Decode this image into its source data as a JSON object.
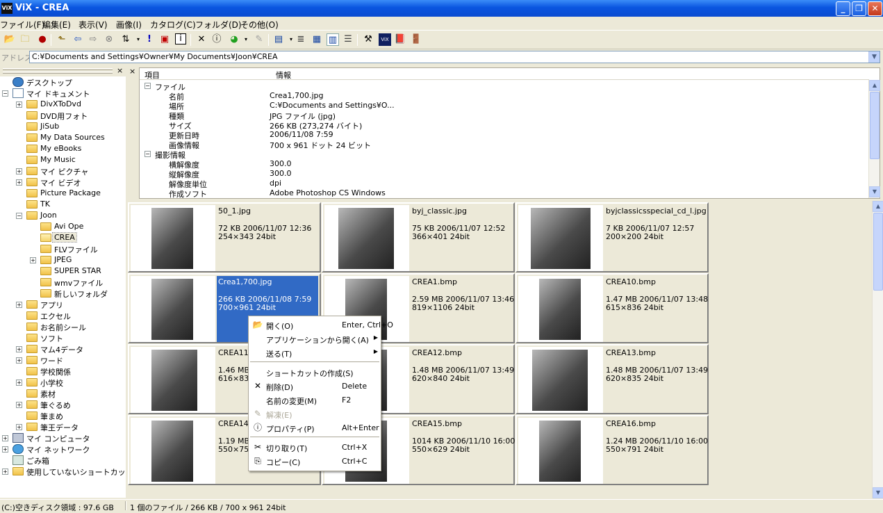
{
  "window": {
    "title": "ViX - CREA",
    "app_icon": "ViX"
  },
  "menu": [
    "ファイル(F)",
    "編集(E)",
    "表示(V)",
    "画像(I)",
    "カタログ(C)",
    "フォルダ(D)",
    "その他(O)"
  ],
  "address": {
    "label": "アドレス",
    "value": "C:¥Documents and Settings¥Owner¥My Documents¥Joon¥CREA"
  },
  "tree": [
    {
      "label": "デスクトップ",
      "icon": "desktop-icon",
      "level": 0,
      "expand": ""
    },
    {
      "label": "マイ ドキュメント",
      "icon": "my-documents-icon",
      "level": 0,
      "expand": "−"
    },
    {
      "label": "DivXToDvd",
      "icon": "folder-icon",
      "level": 1,
      "expand": "+"
    },
    {
      "label": "DVD用フォト",
      "icon": "folder-icon",
      "level": 1,
      "expand": ""
    },
    {
      "label": "JiSub",
      "icon": "folder-icon",
      "level": 1,
      "expand": ""
    },
    {
      "label": "My Data Sources",
      "icon": "folder-icon",
      "level": 1,
      "expand": ""
    },
    {
      "label": "My eBooks",
      "icon": "folder-icon",
      "level": 1,
      "expand": ""
    },
    {
      "label": "My Music",
      "icon": "folder-icon",
      "level": 1,
      "expand": ""
    },
    {
      "label": "マイ ピクチャ",
      "icon": "pictures-folder-icon",
      "level": 1,
      "expand": "+"
    },
    {
      "label": "マイ ビデオ",
      "icon": "video-folder-icon",
      "level": 1,
      "expand": "+"
    },
    {
      "label": "Picture Package",
      "icon": "folder-icon",
      "level": 1,
      "expand": ""
    },
    {
      "label": "TK",
      "icon": "folder-icon",
      "level": 1,
      "expand": ""
    },
    {
      "label": "Joon",
      "icon": "folder-icon",
      "level": 1,
      "expand": "−"
    },
    {
      "label": "Avi Ope",
      "icon": "folder-icon",
      "level": 2,
      "expand": ""
    },
    {
      "label": "CREA",
      "icon": "open-folder-icon",
      "level": 2,
      "expand": "",
      "selected": true
    },
    {
      "label": "FLVファイル",
      "icon": "folder-icon",
      "level": 2,
      "expand": ""
    },
    {
      "label": "JPEG",
      "icon": "folder-icon",
      "level": 2,
      "expand": "+"
    },
    {
      "label": "SUPER STAR",
      "icon": "folder-icon",
      "level": 2,
      "expand": ""
    },
    {
      "label": "wmvファイル",
      "icon": "folder-icon",
      "level": 2,
      "expand": ""
    },
    {
      "label": "新しいフォルダ",
      "icon": "folder-icon",
      "level": 2,
      "expand": ""
    },
    {
      "label": "アプリ",
      "icon": "folder-icon",
      "level": 1,
      "expand": "+"
    },
    {
      "label": "エクセル",
      "icon": "folder-icon",
      "level": 1,
      "expand": ""
    },
    {
      "label": "お名前シール",
      "icon": "folder-icon",
      "level": 1,
      "expand": ""
    },
    {
      "label": "ソフト",
      "icon": "folder-icon",
      "level": 1,
      "expand": ""
    },
    {
      "label": "マム4データ",
      "icon": "folder-icon",
      "level": 1,
      "expand": "+"
    },
    {
      "label": "ワード",
      "icon": "folder-icon",
      "level": 1,
      "expand": "+"
    },
    {
      "label": "学校関係",
      "icon": "folder-icon",
      "level": 1,
      "expand": ""
    },
    {
      "label": "小学校",
      "icon": "folder-icon",
      "level": 1,
      "expand": "+"
    },
    {
      "label": "素材",
      "icon": "folder-icon",
      "level": 1,
      "expand": ""
    },
    {
      "label": "筆ぐるめ",
      "icon": "folder-icon",
      "level": 1,
      "expand": "+"
    },
    {
      "label": "筆まめ",
      "icon": "folder-icon",
      "level": 1,
      "expand": ""
    },
    {
      "label": "筆王データ",
      "icon": "folder-icon",
      "level": 1,
      "expand": "+"
    },
    {
      "label": "マイ コンピュータ",
      "icon": "my-computer-icon",
      "level": 0,
      "expand": "+"
    },
    {
      "label": "マイ ネットワーク",
      "icon": "network-icon",
      "level": 0,
      "expand": "+"
    },
    {
      "label": "ごみ箱",
      "icon": "recycle-bin-icon",
      "level": 0,
      "expand": ""
    },
    {
      "label": "使用していないショートカット",
      "icon": "folder-icon",
      "level": 0,
      "expand": "+"
    }
  ],
  "props": {
    "col_item": "項目",
    "col_info": "情報",
    "rows": [
      {
        "kind": "group",
        "label": "ファイル"
      },
      {
        "kind": "item",
        "label": "名前",
        "value": "Crea1,700.jpg"
      },
      {
        "kind": "item",
        "label": "場所",
        "value": "C:¥Documents and Settings¥O..."
      },
      {
        "kind": "item",
        "label": "種類",
        "value": "JPG ファイル (jpg)"
      },
      {
        "kind": "item",
        "label": "サイズ",
        "value": "266 KB (273,274 バイト)"
      },
      {
        "kind": "item",
        "label": "更新日時",
        "value": "2006/11/08 7:59"
      },
      {
        "kind": "item",
        "label": "画像情報",
        "value": "700 x 961 ドット 24 ビット"
      },
      {
        "kind": "group",
        "label": "撮影情報"
      },
      {
        "kind": "item",
        "label": "横解像度",
        "value": "300.0"
      },
      {
        "kind": "item",
        "label": "縦解像度",
        "value": "300.0"
      },
      {
        "kind": "item",
        "label": "解像度単位",
        "value": "dpi"
      },
      {
        "kind": "item",
        "label": "作成ソフト",
        "value": "Adobe Photoshop CS Windows"
      }
    ]
  },
  "thumbs": [
    {
      "name": "50_1.jpg",
      "meta1": "72 KB  2006/11/07 12:36",
      "meta2": "254×343  24bit",
      "selected": false
    },
    {
      "name": "byj_classic.jpg",
      "meta1": "75 KB  2006/11/07 12:52",
      "meta2": "366×401  24bit",
      "selected": false
    },
    {
      "name": "byjclassicsspecial_cd_l.jpg",
      "meta1": "7 KB  2006/11/07 12:57",
      "meta2": "200×200  24bit",
      "selected": false
    },
    {
      "name": "Crea1,700.jpg",
      "meta1": "266 KB  2006/11/08 7:59",
      "meta2": "700×961  24bit",
      "selected": true
    },
    {
      "name": "CREA1.bmp",
      "meta1": "2.59 MB  2006/11/07 13:46",
      "meta2": "819×1106  24bit",
      "selected": false
    },
    {
      "name": "CREA10.bmp",
      "meta1": "1.47 MB  2006/11/07 13:48",
      "meta2": "615×836  24bit",
      "selected": false
    },
    {
      "name": "CREA11",
      "meta1": "1.46 MB",
      "meta2": "616×83",
      "selected": false
    },
    {
      "name": "CREA12.bmp",
      "meta1": "1.48 MB  2006/11/07 13:49",
      "meta2": "620×840  24bit",
      "selected": false
    },
    {
      "name": "CREA13.bmp",
      "meta1": "1.48 MB  2006/11/07 13:49",
      "meta2": "620×835  24bit",
      "selected": false
    },
    {
      "name": "CREA14",
      "meta1": "1.19 MB",
      "meta2": "550×75",
      "selected": false
    },
    {
      "name": "CREA15.bmp",
      "meta1": "1014 KB  2006/11/10 16:00",
      "meta2": "550×629  24bit",
      "selected": false
    },
    {
      "name": "CREA16.bmp",
      "meta1": "1.24 MB  2006/11/10 16:00",
      "meta2": "550×791  24bit",
      "selected": false
    }
  ],
  "context_menu": [
    {
      "kind": "item",
      "label": "開く(O)",
      "shortcut": "Enter, Ctrl+O",
      "icon": "open-folder-icon",
      "glyph": "📂"
    },
    {
      "kind": "item",
      "label": "アプリケーションから開く(A)",
      "submenu": true
    },
    {
      "kind": "item",
      "label": "送る(T)",
      "submenu": true
    },
    {
      "kind": "sep"
    },
    {
      "kind": "item",
      "label": "ショートカットの作成(S)"
    },
    {
      "kind": "item",
      "label": "削除(D)",
      "shortcut": "Delete",
      "icon": "delete-x-icon",
      "glyph": "✕"
    },
    {
      "kind": "item",
      "label": "名前の変更(M)",
      "shortcut": "F2"
    },
    {
      "kind": "item",
      "label": "解凍(E)",
      "disabled": true,
      "icon": "extract-icon",
      "glyph": "✎"
    },
    {
      "kind": "item",
      "label": "プロパティ(P)",
      "shortcut": "Alt+Enter",
      "icon": "properties-icon",
      "glyph": "ⓘ"
    },
    {
      "kind": "sep"
    },
    {
      "kind": "item",
      "label": "切り取り(T)",
      "shortcut": "Ctrl+X",
      "icon": "scissors-icon",
      "glyph": "✂"
    },
    {
      "kind": "item",
      "label": "コピー(C)",
      "shortcut": "Ctrl+C",
      "icon": "copy-icon",
      "glyph": "⎘"
    }
  ],
  "status": {
    "disk": "(C:)空きディスク領域 : 97.6 GB",
    "selection": "1 個のファイル / 266 KB / 700 x 961 24bit"
  },
  "colors": {
    "titlebar": "#0a55e0",
    "selection": "#316ac5",
    "chrome": "#ece9d8"
  }
}
